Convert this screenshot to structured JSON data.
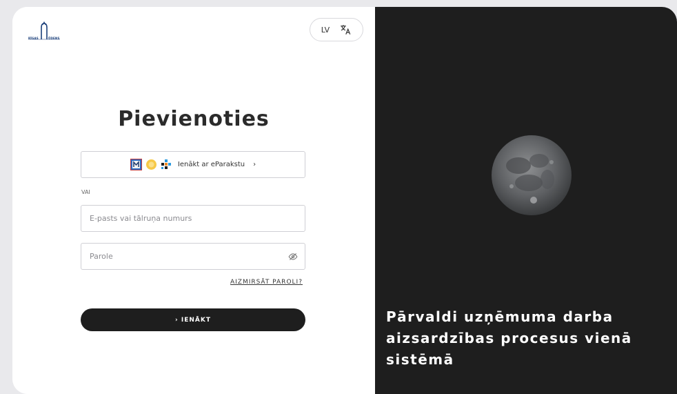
{
  "logo": {
    "left_text": "RĪGAS",
    "right_text": "ŪDENS"
  },
  "language": {
    "code": "LV",
    "icon": "translate-icon"
  },
  "login": {
    "title": "Pievienoties",
    "eparaksts_label": "Ienākt ar eParakstu",
    "eparaksts_chevron": "›",
    "or_label": "VAI",
    "email_placeholder": "E-pasts vai tālruņa numurs",
    "password_placeholder": "Parole",
    "forgot_label": "AIZMIRSĀT PAROLI?",
    "submit_label": "› IENĀKT"
  },
  "promo": {
    "tagline": "Pārvaldi uzņēmuma darba aizsardzības procesus vienā sistēmā"
  },
  "colors": {
    "dark": "#1e1e1e",
    "brand_blue": "#1a3f7a"
  }
}
